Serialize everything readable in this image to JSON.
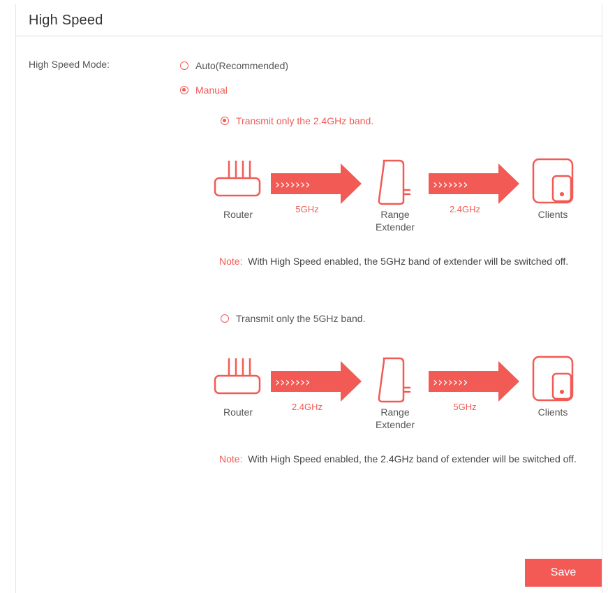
{
  "section": {
    "title": "High Speed"
  },
  "mode": {
    "label": "High Speed Mode:",
    "options": [
      {
        "label": "Auto(Recommended)",
        "checked": false
      },
      {
        "label": "Manual",
        "checked": true
      }
    ]
  },
  "bands": [
    {
      "option_label": "Transmit only the 2.4GHz band.",
      "checked": true,
      "diagram": {
        "router_label": "Router",
        "first_band": "5GHz",
        "extender_label_1": "Range",
        "extender_label_2": "Extender",
        "second_band": "2.4GHz",
        "clients_label": "Clients"
      },
      "note": {
        "prefix": "Note:",
        "text": "With High Speed enabled, the 5GHz band of extender will be switched off."
      }
    },
    {
      "option_label": "Transmit only the 5GHz band.",
      "checked": false,
      "diagram": {
        "router_label": "Router",
        "first_band": "2.4GHz",
        "extender_label_1": "Range",
        "extender_label_2": "Extender",
        "second_band": "5GHz",
        "clients_label": "Clients"
      },
      "note": {
        "prefix": "Note:",
        "text": "With High Speed enabled, the 2.4GHz band of extender will be switched off."
      }
    }
  ],
  "actions": {
    "save_label": "Save"
  },
  "colors": {
    "accent": "#f25a55",
    "text": "#555555",
    "border": "#dcdcdc"
  },
  "icons": [
    "router-icon",
    "arrow-icon",
    "range-extender-icon",
    "clients-icon"
  ]
}
